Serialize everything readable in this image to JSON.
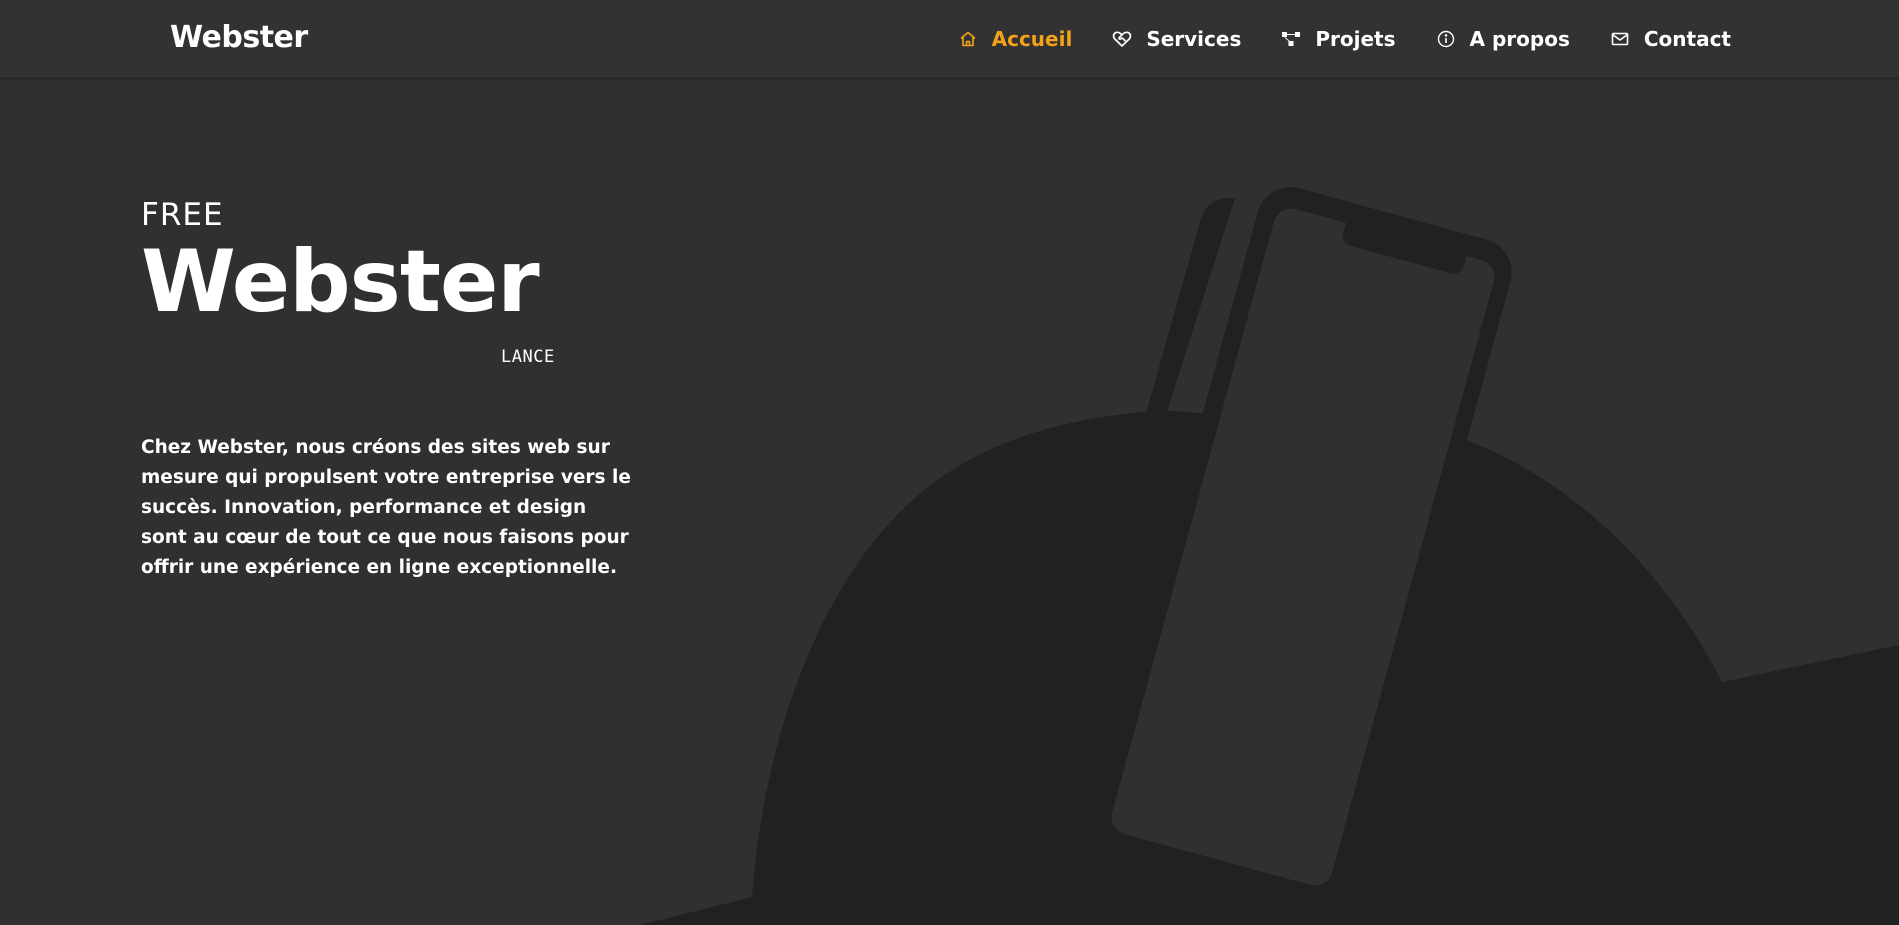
{
  "header": {
    "brand": "Webster",
    "nav": [
      {
        "label": "Accueil",
        "icon": "home-icon",
        "active": true
      },
      {
        "label": "Services",
        "icon": "heart-handshake-icon",
        "active": false
      },
      {
        "label": "Projets",
        "icon": "hierarchy-icon",
        "active": false
      },
      {
        "label": "A propos",
        "icon": "info-icon",
        "active": false
      },
      {
        "label": "Contact",
        "icon": "mail-icon",
        "active": false
      }
    ]
  },
  "hero": {
    "pre": "FREE",
    "title": "Webster",
    "suffix": "LANCE",
    "description": "Chez Webster, nous créons des sites web sur mesure qui propulsent votre entreprise vers le succès. Innovation, performance et design sont au cœur de tout ce que nous faisons pour offrir une expérience en ligne exceptionnelle."
  },
  "colors": {
    "background": "#303030",
    "header": "#323232",
    "accent": "#f4a21b",
    "illustration": "#212121"
  }
}
